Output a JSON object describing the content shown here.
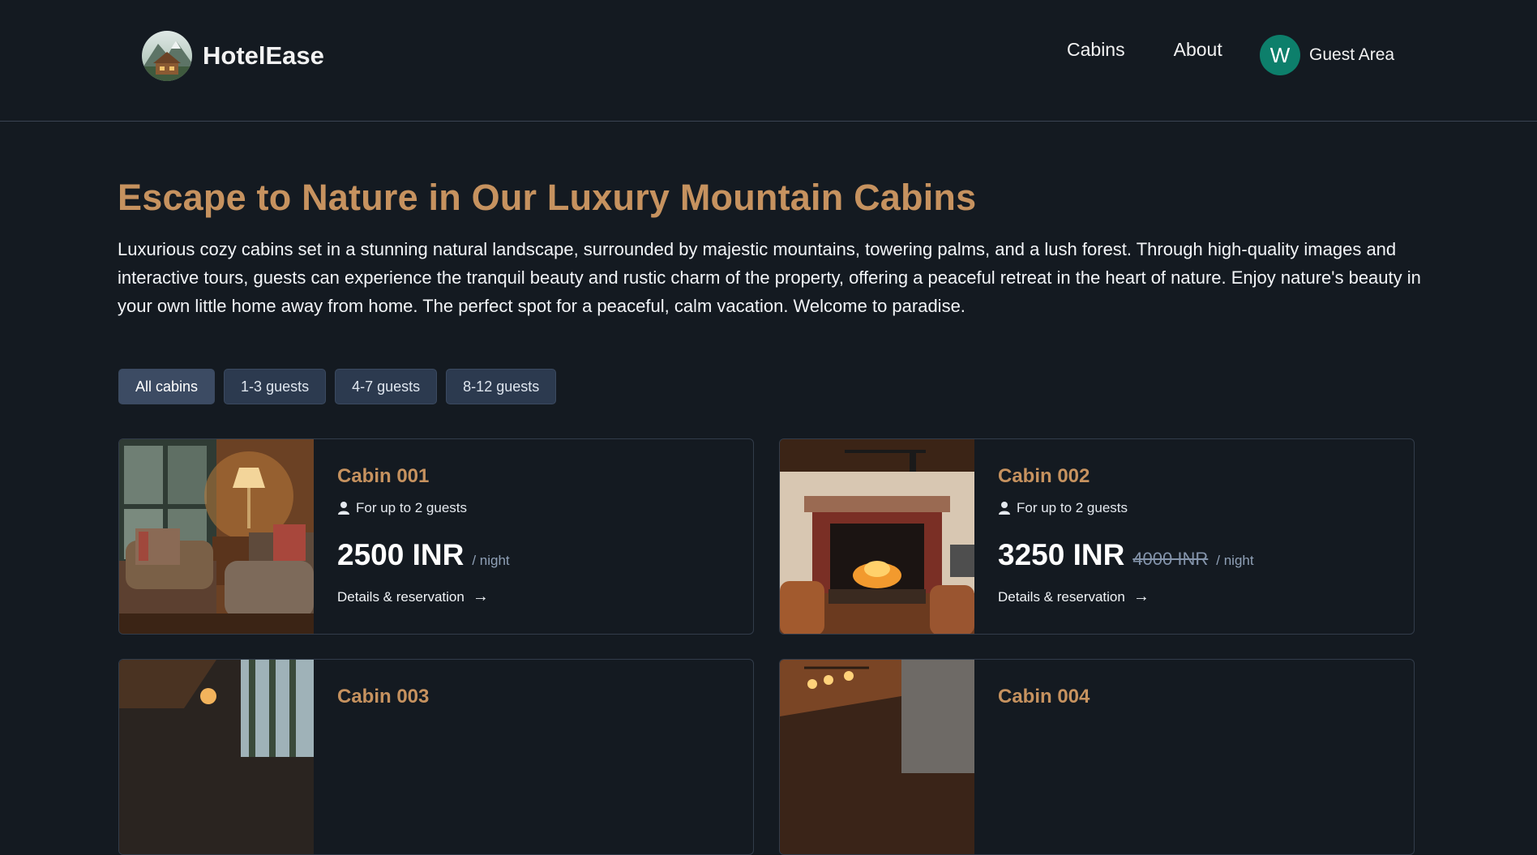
{
  "header": {
    "brand": "HotelEase",
    "nav": {
      "cabins": "Cabins",
      "about": "About"
    },
    "guest": {
      "initial": "W",
      "label": "Guest Area",
      "avatar_color": "#0d7f6b"
    }
  },
  "hero": {
    "title": "Escape to Nature in Our Luxury Mountain Cabins",
    "description": "Luxurious cozy cabins set in a stunning natural landscape, surrounded by majestic mountains, towering palms, and a lush forest. Through high-quality images and interactive tours, guests can experience the tranquil beauty and rustic charm of the property, offering a peaceful retreat in the heart of nature. Enjoy nature's beauty in your own little home away from home. The perfect spot for a peaceful, calm vacation. Welcome to paradise."
  },
  "filters": [
    "All cabins",
    "1-3 guests",
    "4-7 guests",
    "8-12 guests"
  ],
  "active_filter": "All cabins",
  "cabins": [
    {
      "name": "Cabin 001",
      "guests": "For up to 2 guests",
      "price": "2500 INR",
      "regular_price": "",
      "per_night": "/ night",
      "link": "Details & reservation"
    },
    {
      "name": "Cabin 002",
      "guests": "For up to 2 guests",
      "price": "3250 INR",
      "regular_price": "4000 INR",
      "per_night": "/ night",
      "link": "Details & reservation"
    },
    {
      "name": "Cabin 003"
    },
    {
      "name": "Cabin 004"
    }
  ],
  "colors": {
    "accent": "#c6925f",
    "background": "#141a21",
    "filter_bg": "#2c3a4f"
  }
}
